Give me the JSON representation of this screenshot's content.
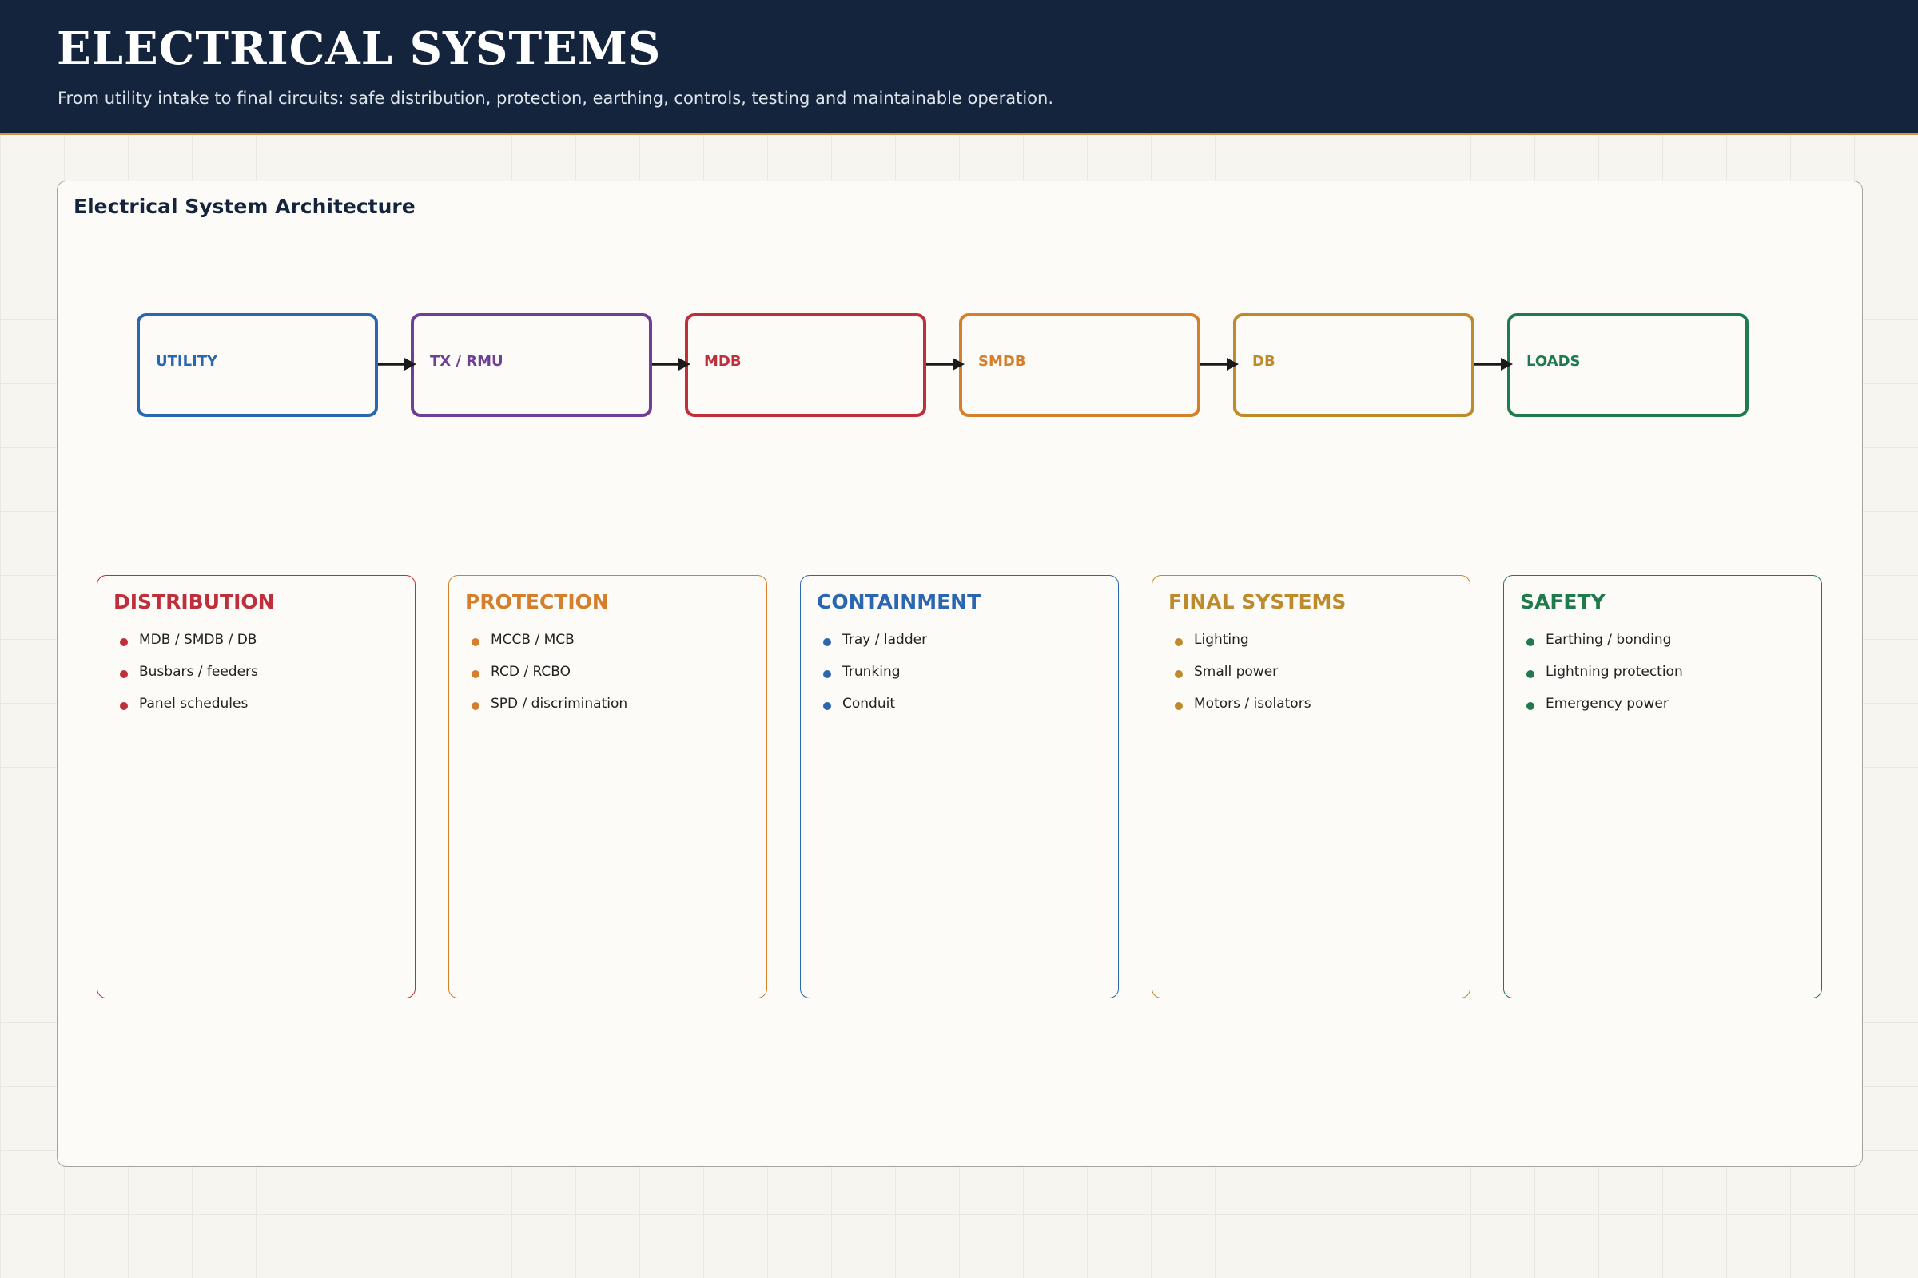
{
  "header": {
    "title": "ELECTRICAL SYSTEMS",
    "subtitle": "From utility intake to final circuits: safe distribution, protection, earthing, controls, testing and maintainable operation."
  },
  "panel": {
    "title": "Electrical System Architecture"
  },
  "flow": [
    {
      "label": "UTILITY",
      "color": "#2b66b0"
    },
    {
      "label": "TX / RMU",
      "color": "#6e3f96"
    },
    {
      "label": "MDB",
      "color": "#bf2f3b"
    },
    {
      "label": "SMDB",
      "color": "#d57e2b"
    },
    {
      "label": "DB",
      "color": "#bd8a2c"
    },
    {
      "label": "LOADS",
      "color": "#1f7a4d"
    }
  ],
  "cards": [
    {
      "title": "DISTRIBUTION",
      "color": "#bf2f3b",
      "items": [
        "MDB / SMDB / DB",
        "Busbars / feeders",
        "Panel schedules"
      ]
    },
    {
      "title": "PROTECTION",
      "color": "#d57e2b",
      "items": [
        "MCCB / MCB",
        "RCD / RCBO",
        "SPD / discrimination"
      ]
    },
    {
      "title": "CONTAINMENT",
      "color": "#2b66b0",
      "items": [
        "Tray / ladder",
        "Trunking",
        "Conduit"
      ]
    },
    {
      "title": "FINAL SYSTEMS",
      "color": "#bd8a2c",
      "items": [
        "Lighting",
        "Small power",
        "Motors / isolators"
      ]
    },
    {
      "title": "SAFETY",
      "color": "#1f7a4d",
      "items": [
        "Earthing / bonding",
        "Lightning protection",
        "Emergency power"
      ]
    }
  ]
}
